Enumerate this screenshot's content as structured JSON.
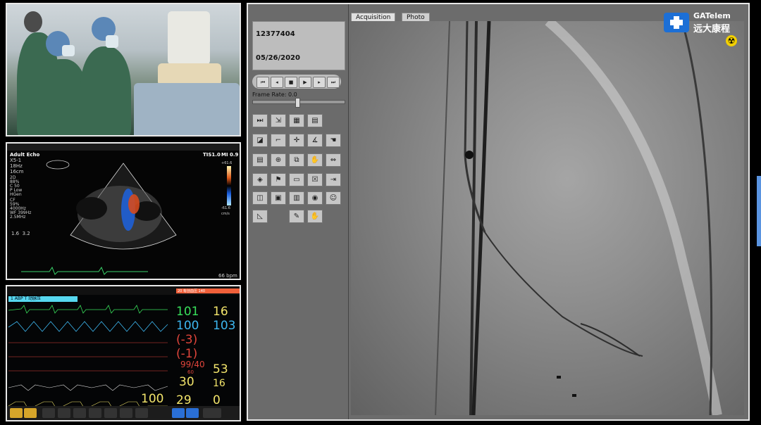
{
  "logo": {
    "brand_en": "GATelem",
    "brand_cn": "远大康程",
    "reg": "®"
  },
  "echo": {
    "mode": "Adult Echo",
    "probe": "X5-1",
    "freq": "18Hz",
    "depth": "16cm",
    "params": "2D\n88%\nC 50\nP Low\nHGen",
    "cf": "CF\n59%\n4000Hz\nWF 399Hz\n2.5MHz",
    "ti": "TIS1.0",
    "mi": "MI 0.9",
    "ratio": "1.6  3.2",
    "bpm": "66 bpm",
    "scale_top": "+61.6",
    "scale_bottom": "-61.6",
    "scale_unit": "cm/s"
  },
  "monitor": {
    "tab": "1  ABP T 动脉压",
    "alarm": "20  有创血压 140",
    "values": {
      "hr": "101",
      "spo2": "100",
      "pr": "16",
      "nibp": "103",
      "cvp": "(-3)",
      "pa": "(-1)",
      "abp": "99/40",
      "abp_mean": "60",
      "resp": "53",
      "etco2": "30",
      "awrr": "16",
      "pleth": "100",
      "temp": "29",
      "extra": "0"
    }
  },
  "fluoro": {
    "patient_id": "12377404",
    "date": "05/26/2020",
    "frame_rate_label": "Frame Rate: 0.0",
    "tabs": [
      {
        "label": "Acquisition"
      },
      {
        "label": "Photo"
      }
    ],
    "transport": [
      "⏮",
      "◂",
      "■",
      "▶",
      "▸",
      "⏭"
    ]
  },
  "colors": {
    "accent": "#5a94e0",
    "hr": "#38e05b",
    "spo2": "#3db7f0",
    "abp": "#e0453b",
    "cvp": "#f07a3a",
    "etco2": "#f3e56b"
  }
}
